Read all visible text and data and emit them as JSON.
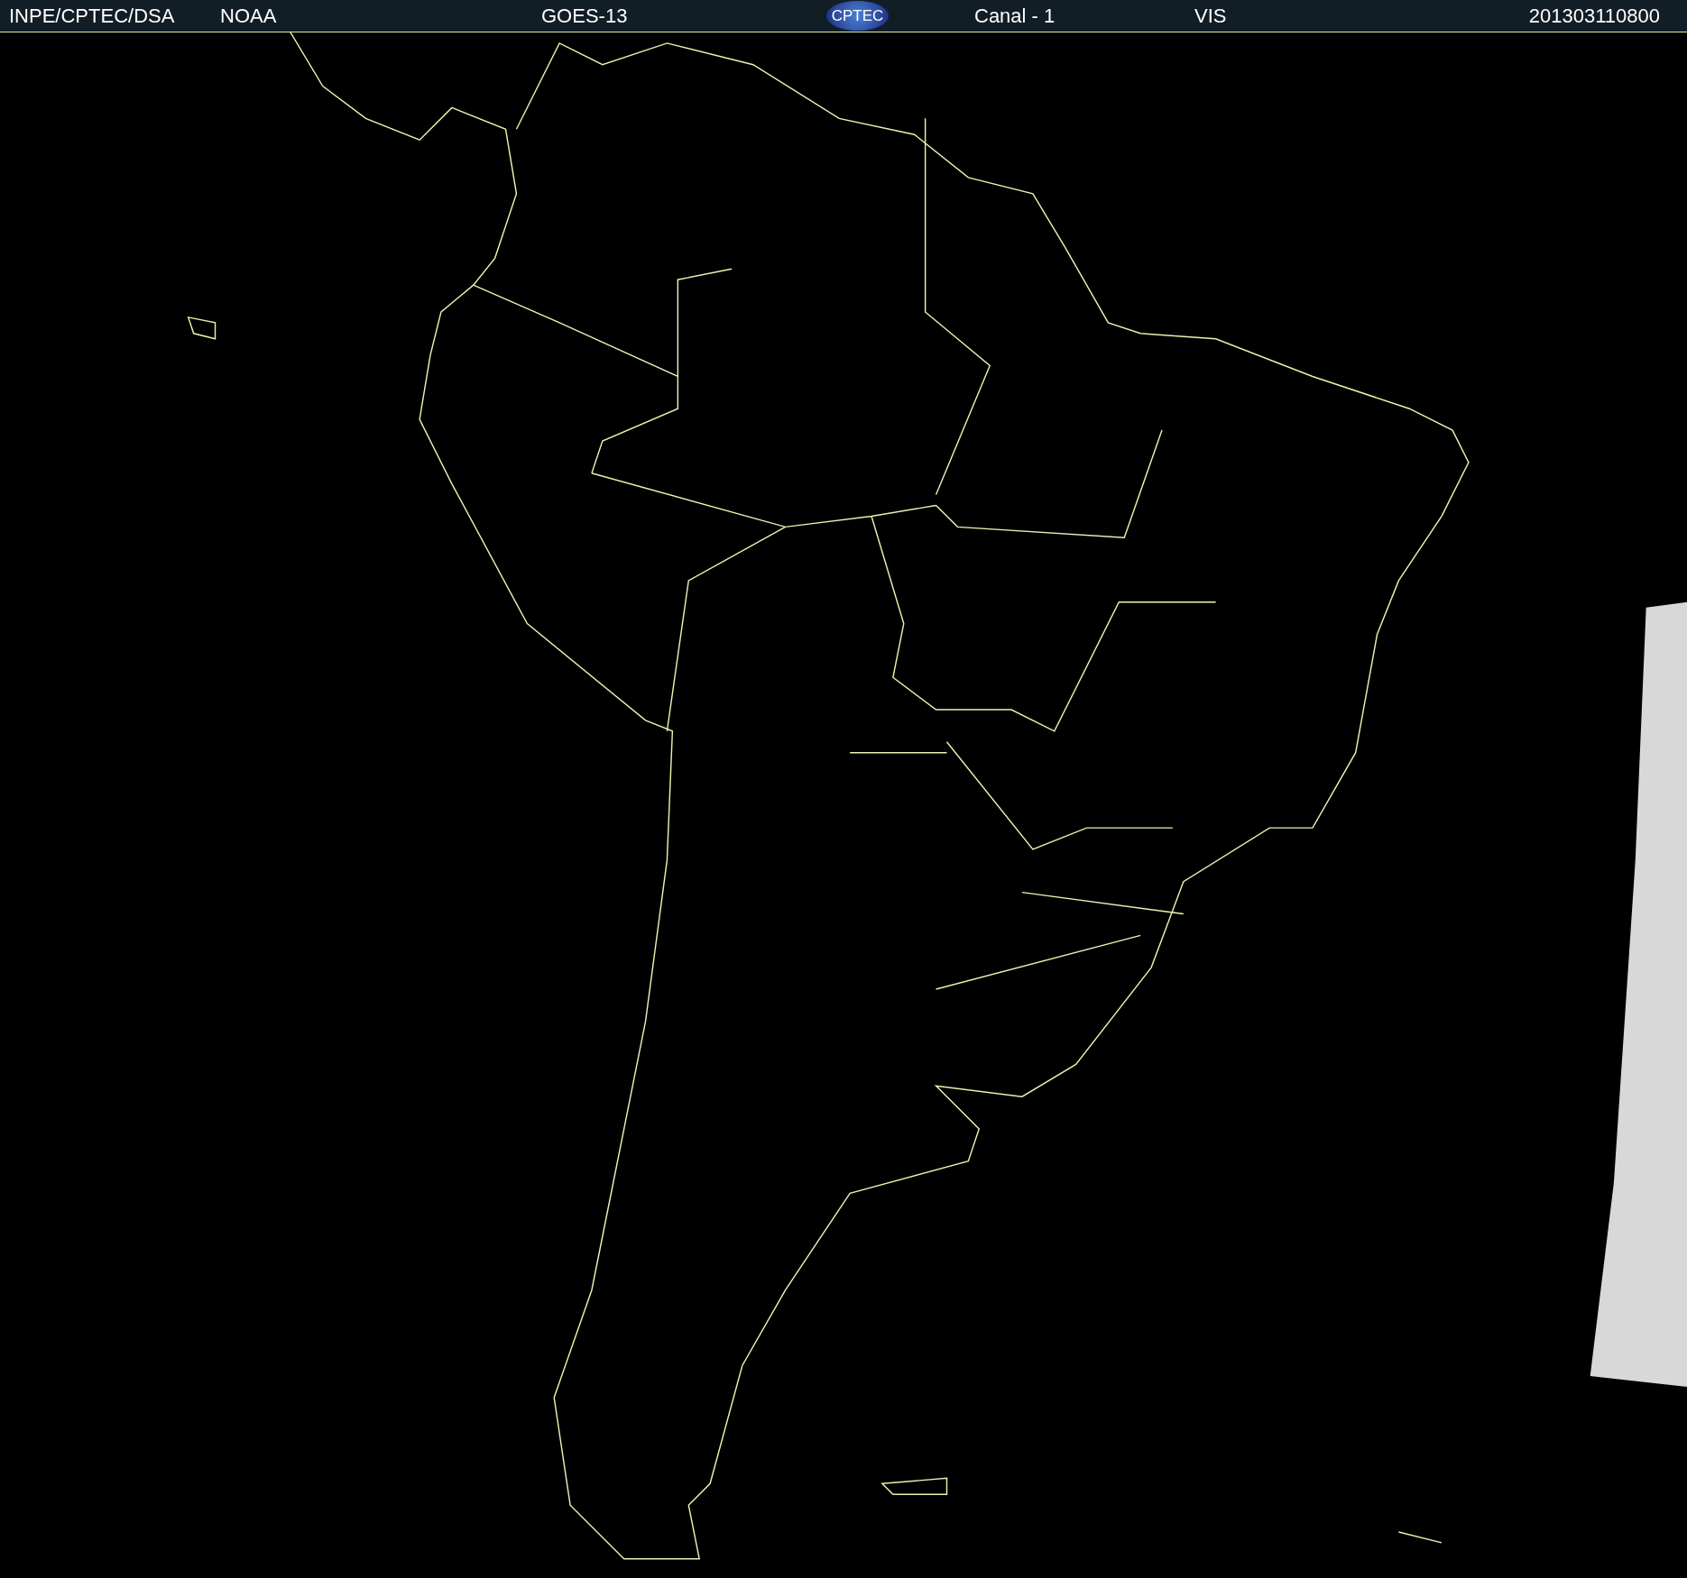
{
  "header": {
    "source": "INPE/CPTEC/DSA",
    "agency": "NOAA",
    "satellite": "GOES-13",
    "logo": "CPTEC",
    "channel": "Canal - 1",
    "band": "VIS",
    "timestamp": "201303110800"
  }
}
